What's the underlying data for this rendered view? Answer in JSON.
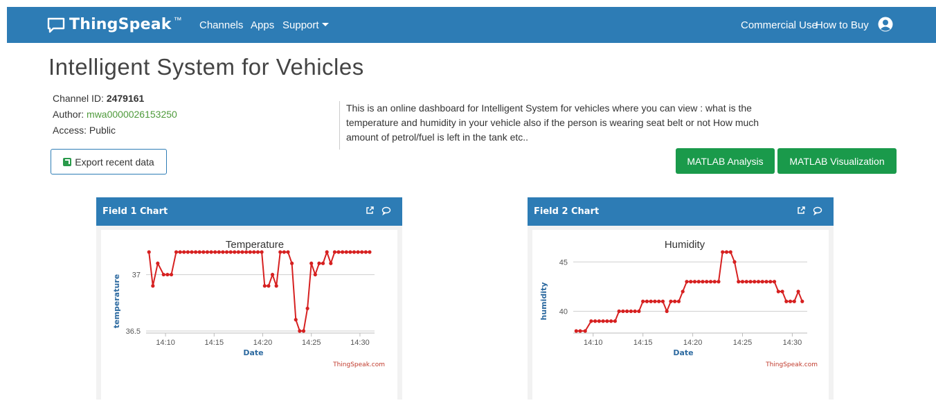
{
  "nav": {
    "brand": "ThingSpeak",
    "tm": "™",
    "links": [
      "Channels",
      "Apps",
      "Support"
    ],
    "right_links": [
      "Commercial Use",
      "How to Buy"
    ]
  },
  "channel": {
    "title": "Intelligent System for Vehicles",
    "id_label": "Channel ID: ",
    "id": "2479161",
    "author_label": "Author: ",
    "author": "mwa0000026153250",
    "access": "Access: Public",
    "description": "This is an online dashboard for Intelligent System for vehicles where you can view : what is the temperature and humidity in your vehicle also if the person is wearing seat belt or not How much amount of petrol/fuel is left in the tank etc..",
    "export_label": "Export recent data",
    "matlab_analysis": "MATLAB Analysis",
    "matlab_visualization": "MATLAB Visualization"
  },
  "panels": [
    {
      "title": "Field 1 Chart"
    },
    {
      "title": "Field 2 Chart"
    }
  ],
  "icons": [
    "chat-icon",
    "external-link-icon",
    "export-icon",
    "user-avatar-icon",
    "chevron-down-icon"
  ],
  "colors": {
    "navbar": "#2d7cb5",
    "accent_green": "#1a9a4b",
    "series": "#d62020"
  },
  "chart_data": [
    {
      "type": "line",
      "title": "Temperature",
      "xlabel": "Date",
      "ylabel": "temperature",
      "credit": "ThingSpeak.com",
      "x_ticks": [
        "14:10",
        "14:15",
        "14:20",
        "14:25",
        "14:30"
      ],
      "y_ticks": [
        36.5,
        37
      ],
      "ylim": [
        36.5,
        37.2
      ],
      "xlim": [
        8.0,
        31.5
      ],
      "x": [
        8.3,
        8.7,
        9.2,
        9.8,
        10.2,
        10.6,
        11.1,
        11.5,
        11.9,
        12.3,
        12.7,
        13.1,
        13.5,
        13.9,
        14.3,
        14.7,
        15.1,
        15.5,
        15.9,
        16.3,
        16.7,
        17.1,
        17.5,
        17.9,
        18.3,
        18.7,
        19.1,
        19.5,
        19.9,
        20.2,
        20.6,
        21.0,
        21.4,
        21.8,
        22.2,
        22.6,
        23.0,
        23.4,
        23.8,
        24.2,
        24.6,
        25.0,
        25.4,
        25.8,
        26.2,
        26.6,
        27.0,
        27.4,
        27.8,
        28.2,
        28.6,
        29.0,
        29.4,
        29.8,
        30.2,
        30.6,
        31.0
      ],
      "values": [
        37.2,
        36.9,
        37.1,
        37.0,
        37.0,
        37.0,
        37.2,
        37.2,
        37.2,
        37.2,
        37.2,
        37.2,
        37.2,
        37.2,
        37.2,
        37.2,
        37.2,
        37.2,
        37.2,
        37.2,
        37.2,
        37.2,
        37.2,
        37.2,
        37.2,
        37.2,
        37.2,
        37.2,
        37.2,
        36.9,
        36.9,
        37.0,
        36.9,
        37.2,
        37.2,
        37.2,
        37.1,
        36.6,
        36.5,
        36.5,
        36.7,
        37.1,
        37.0,
        37.1,
        37.1,
        37.2,
        37.1,
        37.2,
        37.2,
        37.2,
        37.2,
        37.2,
        37.2,
        37.2,
        37.2,
        37.2,
        37.2
      ]
    },
    {
      "type": "line",
      "title": "Humidity",
      "xlabel": "Date",
      "ylabel": "humidity",
      "credit": "ThingSpeak.com",
      "x_ticks": [
        "14:10",
        "14:15",
        "14:20",
        "14:25",
        "14:30"
      ],
      "y_ticks": [
        40,
        45
      ],
      "ylim": [
        38,
        46
      ],
      "xlim": [
        8.0,
        31.5
      ],
      "x": [
        8.3,
        8.7,
        9.2,
        9.8,
        10.2,
        10.6,
        11.0,
        11.4,
        11.8,
        12.2,
        12.6,
        13.0,
        13.4,
        13.8,
        14.2,
        14.6,
        15.0,
        15.4,
        15.8,
        16.2,
        16.6,
        17.0,
        17.4,
        17.8,
        18.2,
        18.6,
        19.0,
        19.4,
        19.8,
        20.2,
        20.6,
        21.0,
        21.4,
        21.8,
        22.2,
        22.6,
        23.0,
        23.4,
        23.8,
        24.2,
        24.6,
        25.0,
        25.4,
        25.8,
        26.2,
        26.6,
        27.0,
        27.4,
        27.8,
        28.2,
        28.6,
        29.0,
        29.4,
        29.8,
        30.2,
        30.6,
        31.0
      ],
      "values": [
        38,
        38,
        38,
        39,
        39,
        39,
        39,
        39,
        39,
        39,
        40,
        40,
        40,
        40,
        40,
        40,
        41,
        41,
        41,
        41,
        41,
        41,
        40,
        41,
        41,
        41,
        42,
        43,
        43,
        43,
        43,
        43,
        43,
        43,
        43,
        43,
        46,
        46,
        46,
        45,
        43,
        43,
        43,
        43,
        43,
        43,
        43,
        43,
        43,
        43,
        42,
        42,
        41,
        41,
        41,
        42,
        41
      ]
    }
  ]
}
